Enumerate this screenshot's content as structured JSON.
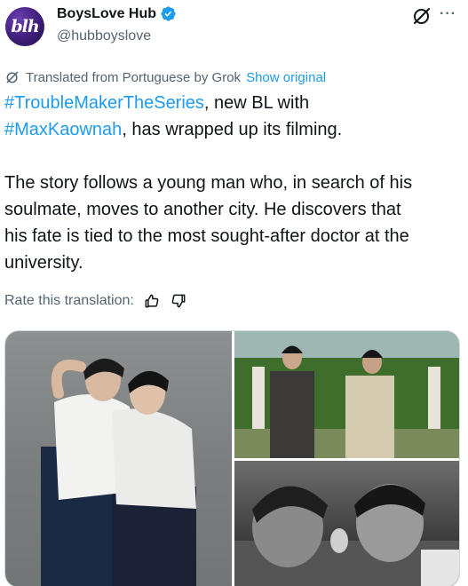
{
  "author": {
    "avatar_text": "blh",
    "display_name": "BoysLove Hub",
    "handle": "@hubboyslove"
  },
  "translation": {
    "notice": "Translated from Portuguese by Grok",
    "show_original": "Show original"
  },
  "tweet": {
    "line1_tag": "#TroubleMakerTheSeries",
    "line1_rest": ", new BL with",
    "line2_tag": "#MaxKaownah",
    "line2_rest": ", has wrapped up its filming.",
    "para2_line1": "The story follows a young man who, in search of his",
    "para2_line2": "soulmate, moves to another city. He discovers that",
    "para2_line3": "his fate is tied to the most sought-after doctor at the",
    "para2_line4": "university."
  },
  "rate": {
    "label": "Rate this translation:"
  },
  "icons": {
    "verified": "verified-badge-icon",
    "grok": "grok-icon",
    "more": "more-icon",
    "thumbs_up": "thumbs-up-icon",
    "thumbs_down": "thumbs-down-icon"
  },
  "more_glyph": "···",
  "colors": {
    "accent": "#1d9bf0",
    "secondary_text": "#536471",
    "primary_text": "#0f1419"
  }
}
